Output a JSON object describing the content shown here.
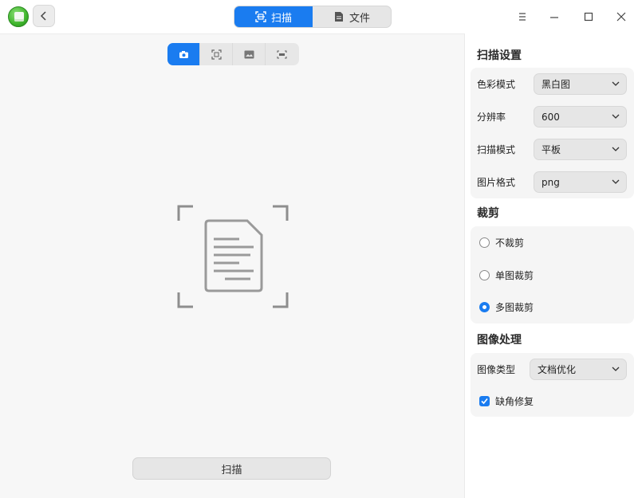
{
  "header": {
    "tabs": [
      {
        "label": "扫描",
        "icon": "scan-icon",
        "active": true
      },
      {
        "label": "文件",
        "icon": "file-icon",
        "active": false
      }
    ],
    "window_controls": [
      "menu-icon",
      "minimize-icon",
      "maximize-icon",
      "close-icon"
    ]
  },
  "main": {
    "modes": [
      "camera-icon",
      "qr-scan-icon",
      "image-icon",
      "barcode-icon"
    ],
    "scan_button": "扫描"
  },
  "panel": {
    "scan_settings": {
      "title": "扫描设置",
      "rows": [
        {
          "label": "色彩模式",
          "value": "黑白图"
        },
        {
          "label": "分辨率",
          "value": "600"
        },
        {
          "label": "扫描模式",
          "value": "平板"
        },
        {
          "label": "图片格式",
          "value": "png"
        }
      ]
    },
    "crop": {
      "title": "裁剪",
      "options": [
        {
          "label": "不裁剪",
          "checked": false
        },
        {
          "label": "单图裁剪",
          "checked": false
        },
        {
          "label": "多图裁剪",
          "checked": true
        }
      ]
    },
    "image_processing": {
      "title": "图像处理",
      "type_label": "图像类型",
      "type_value": "文档优化",
      "repair_label": "缺角修复",
      "repair_checked": true
    }
  },
  "colors": {
    "accent": "#1a7cf0"
  }
}
